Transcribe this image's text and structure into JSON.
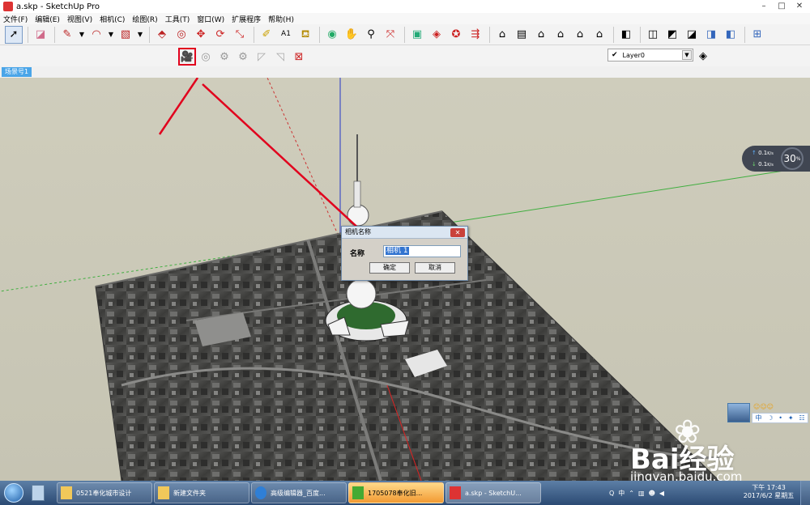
{
  "window": {
    "title": "a.skp - SketchUp Pro",
    "controls": [
      "–",
      "□",
      "✕"
    ]
  },
  "menu": [
    "文件(F)",
    "编辑(E)",
    "视图(V)",
    "相机(C)",
    "绘图(R)",
    "工具(T)",
    "窗口(W)",
    "扩展程序",
    "帮助(H)"
  ],
  "layer": {
    "current": "Layer0"
  },
  "scene_tab": "场景号1",
  "network": {
    "up": "0.1",
    "down": "0.1",
    "unit": "K/s",
    "percent": "30",
    "percent_unit": "%"
  },
  "dialog": {
    "title": "相机名称",
    "label": "名称",
    "value": "相机 1",
    "ok": "确定",
    "cancel": "取消",
    "close": "✕"
  },
  "ime": {
    "stars": "☺☺☺",
    "items": [
      "中",
      "☽",
      "•",
      "✦",
      "☷"
    ]
  },
  "watermark": {
    "logo": "Bai经验",
    "url": "jingyan.baidu.com"
  },
  "taskbar": {
    "items": [
      {
        "label": "0521奉化城市设计",
        "state": "normal"
      },
      {
        "label": "新建文件夹",
        "state": "normal"
      },
      {
        "label": "高级编辑器_百度...",
        "state": "normal"
      },
      {
        "label": "1705078奉化旧...",
        "state": "active"
      },
      {
        "label": "a.skp - SketchU...",
        "state": "current"
      }
    ],
    "tray": [
      "Q",
      "中",
      "⌃"
    ],
    "time": "下午 17:43",
    "date": "2017/6/2 星期五"
  },
  "colors": {
    "accent_red": "#e1001d",
    "scene_tab": "#4aa5e8",
    "sky": "#cfcdbc"
  }
}
